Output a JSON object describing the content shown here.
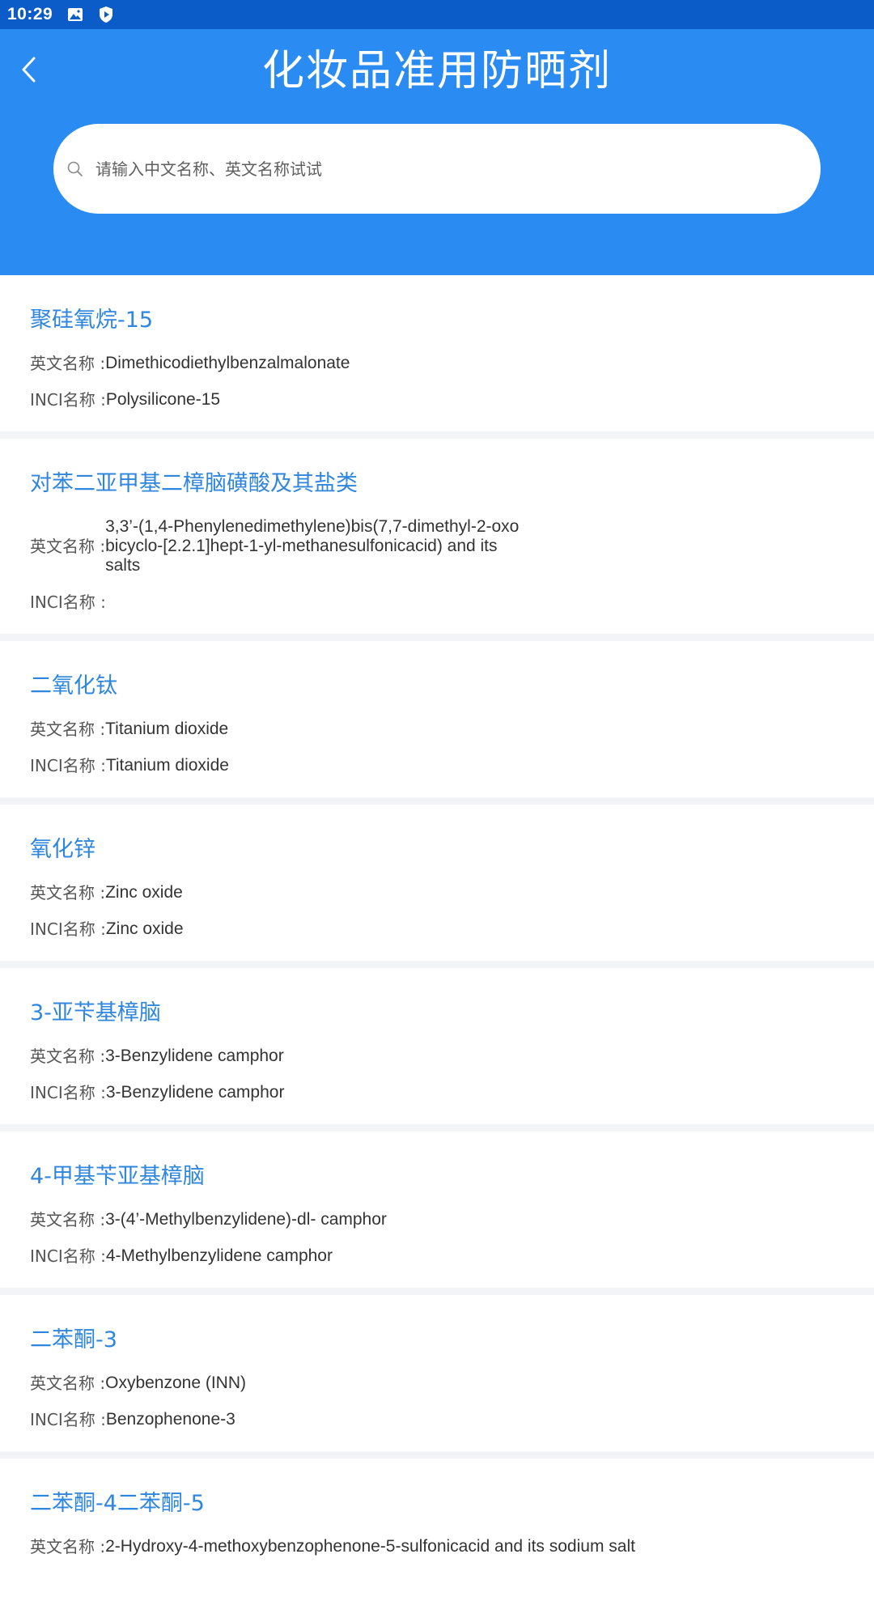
{
  "status_bar": {
    "time": "10:29",
    "icons": [
      "image-icon",
      "shield-play-icon"
    ]
  },
  "header": {
    "title": "化妆品准用防晒剂",
    "back_icon": "chevron-left-icon",
    "background_color": "#2a8bf2"
  },
  "search": {
    "placeholder": "请输入中文名称、英文名称试试",
    "value": ""
  },
  "labels": {
    "english": "英文名称 : ",
    "inci": "INCI名称 : "
  },
  "items": [
    {
      "name": "聚硅氧烷-15",
      "english": "Dimethicodiethylbenzalmalonate",
      "inci": "Polysilicone-15"
    },
    {
      "name": "对苯二亚甲基二樟脑磺酸及其盐类",
      "english": "3,3’-(1,4-Phenylenedimethylene)bis(7,7-dimethyl-2-oxo\nbicyclo-[2.2.1]hept-1-yl-methanesulfonicacid) and its\nsalts",
      "inci": ""
    },
    {
      "name": "二氧化钛",
      "english": "Titanium dioxide",
      "inci": "Titanium dioxide"
    },
    {
      "name": "氧化锌",
      "english": "Zinc oxide",
      "inci": "Zinc oxide"
    },
    {
      "name": "3-亚苄基樟脑",
      "english": "3-Benzylidene camphor",
      "inci": "3-Benzylidene camphor"
    },
    {
      "name": "4-甲基苄亚基樟脑",
      "english": "3-(4’-Methylbenzylidene)-dl- camphor",
      "inci": "4-Methylbenzylidene camphor"
    },
    {
      "name": "二苯酮-3",
      "english": "Oxybenzone (INN)",
      "inci": "Benzophenone-3"
    },
    {
      "name": "二苯酮-4二苯酮-5",
      "english": "2-Hydroxy-4-methoxybenzophenone-5-sulfonicacid and its sodium salt",
      "inci": ""
    }
  ]
}
